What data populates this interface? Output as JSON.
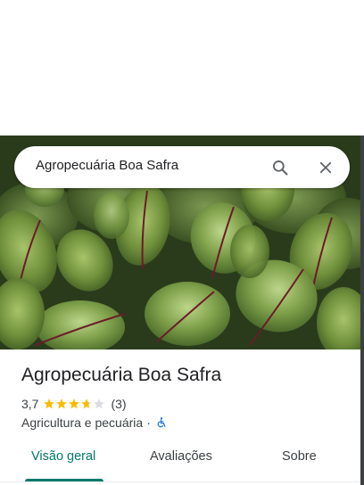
{
  "search": {
    "query": "Agropecuária Boa Safra"
  },
  "place": {
    "name": "Agropecuária Boa Safra",
    "rating": "3,7",
    "rating_value": 3.7,
    "max_stars": 5,
    "review_count": "(3)",
    "category": "Agricultura e pecuária",
    "separator": "·"
  },
  "icons": {
    "search": "search-icon",
    "close": "close-icon",
    "accessibility": "wheelchair-accessible-icon",
    "photo": "beet-leaves-photo"
  },
  "tabs": [
    {
      "label": "Visão geral",
      "active": true
    },
    {
      "label": "Avaliações",
      "active": false
    },
    {
      "label": "Sobre",
      "active": false
    }
  ],
  "colors": {
    "accent": "#00796b",
    "star": "#fbbc04",
    "star_empty": "#dadce0",
    "access_icon": "#1a73e8"
  }
}
